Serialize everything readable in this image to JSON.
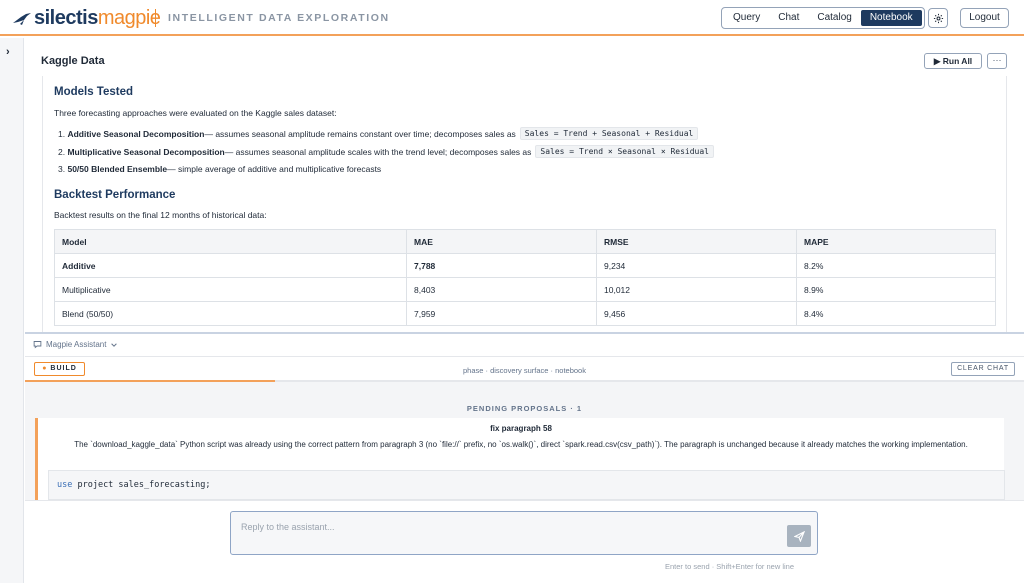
{
  "app": {
    "logo_part1": "silectis",
    "logo_part2": "magpie",
    "tagline": "INTELLIGENT DATA EXPLORATION"
  },
  "nav": {
    "tabs": [
      {
        "label": "Query"
      },
      {
        "label": "Chat"
      },
      {
        "label": "Catalog"
      },
      {
        "label": "Notebook",
        "active": true
      }
    ],
    "settings_icon": "gear-icon",
    "logout_label": "Logout"
  },
  "notebook": {
    "title": "Kaggle Data",
    "run_all_label": "Run All",
    "more_label": "···",
    "models": {
      "heading": "Models Tested",
      "intro": "Three forecasting approaches were evaluated on the Kaggle sales dataset:",
      "items": [
        {
          "num": "1.",
          "name": "Additive Seasonal Decomposition",
          "desc": " — assumes seasonal amplitude remains constant over time; decomposes sales as",
          "code": "Sales = Trend + Seasonal + Residual"
        },
        {
          "num": "2.",
          "name": "Multiplicative Seasonal Decomposition",
          "desc": " — assumes seasonal amplitude scales with the trend level; decomposes sales as",
          "code": "Sales = Trend × Seasonal × Residual"
        },
        {
          "num": "3.",
          "name": "50/50 Blended Ensemble",
          "desc": " — simple average of additive and multiplicative forecasts",
          "code": ""
        }
      ]
    },
    "backtest": {
      "heading": "Backtest Performance",
      "intro": "Backtest results on the final 12 months of historical data:",
      "columns": [
        "Model",
        "MAE",
        "RMSE",
        "MAPE"
      ],
      "rows": [
        {
          "model": "Additive",
          "mae": "7,788",
          "rmse": "9,234",
          "mape": "8.2%"
        },
        {
          "model": "Multiplicative",
          "mae": "8,403",
          "rmse": "10,012",
          "mape": "8.9%"
        },
        {
          "model": "Blend (50/50)",
          "mae": "7,959",
          "rmse": "9,456",
          "mape": "8.4%"
        }
      ]
    }
  },
  "assistant": {
    "title": "Magpie Assistant",
    "build_label": "BUILD",
    "phase_text": "phase · discovery surface · notebook",
    "clear_label": "CLEAR CHAT",
    "progress": 0.25,
    "pending_label": "PENDING PROPOSALS · 1",
    "proposal": {
      "title": "fix paragraph 58",
      "description": "The `download_kaggle_data` Python script was already using the correct pattern from paragraph 3 (no `file://` prefix, no `os.walk()`, direct `spark.read.csv(csv_path)`). The paragraph is unchanged because it already matches the working implementation.",
      "code_keyword": "use",
      "code_rest": " project sales_forecasting;"
    },
    "input_placeholder": "Reply to the assistant...",
    "hint": "Enter to send · Shift+Enter for new line"
  }
}
